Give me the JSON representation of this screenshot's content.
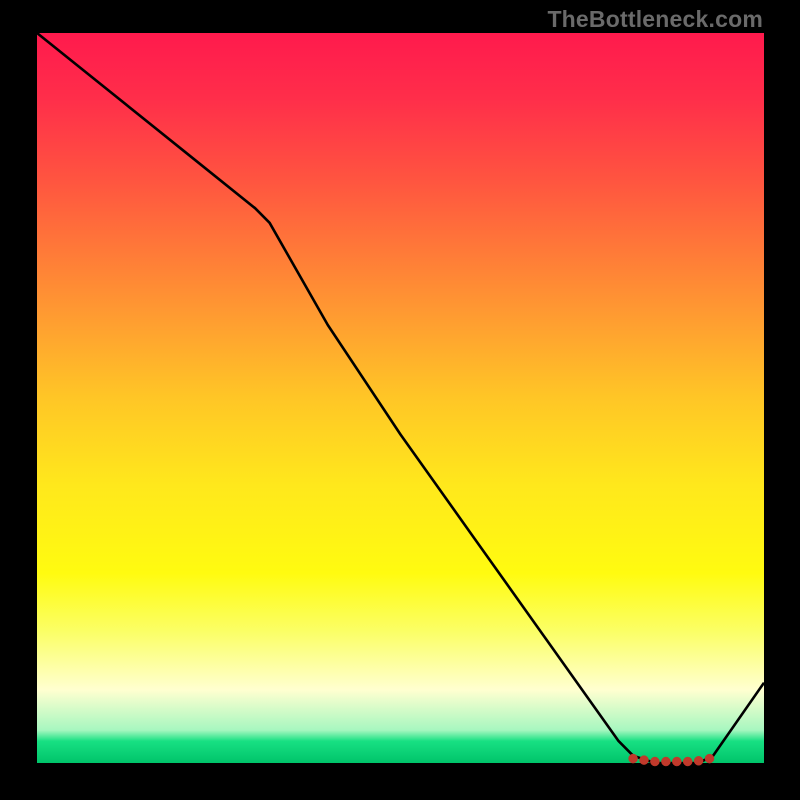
{
  "watermark": "TheBottleneck.com",
  "chart_data": {
    "type": "line",
    "title": "",
    "xlabel": "",
    "ylabel": "",
    "xlim": [
      0,
      100
    ],
    "ylim": [
      0,
      100
    ],
    "grid": false,
    "legend": false,
    "line": {
      "x": [
        0,
        10,
        20,
        30,
        32,
        40,
        50,
        60,
        70,
        80,
        82,
        85,
        88,
        91,
        93,
        100
      ],
      "y": [
        100,
        92,
        84,
        76,
        74,
        60,
        45,
        31,
        17,
        3,
        1,
        0,
        0,
        0,
        1,
        11
      ]
    },
    "markers": {
      "x": [
        82,
        83.5,
        85,
        86.5,
        88,
        89.5,
        91,
        92.5
      ],
      "y": [
        0.6,
        0.4,
        0.2,
        0.2,
        0.2,
        0.2,
        0.3,
        0.6
      ]
    },
    "colors": {
      "gradient_top": "#ff1a4d",
      "gradient_mid": "#ffe81c",
      "gradient_bottom": "#00c46a",
      "line": "#000000",
      "marker": "#c0392b"
    }
  }
}
